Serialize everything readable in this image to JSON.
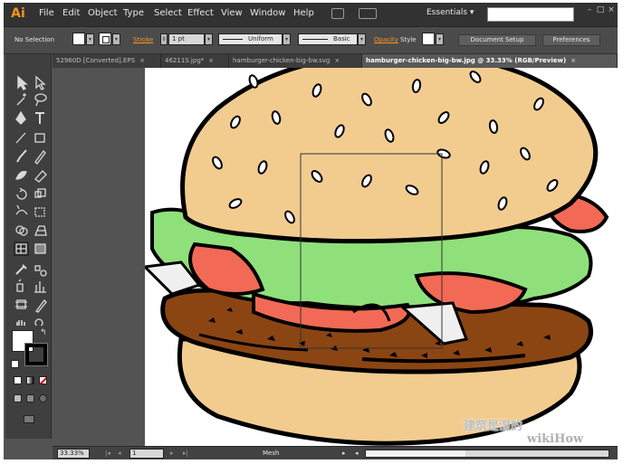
{
  "app": {
    "logo": "Ai",
    "menu": [
      "File",
      "Edit",
      "Object",
      "Type",
      "Select",
      "Effect",
      "View",
      "Window",
      "Help"
    ],
    "workspace": "Essentials",
    "workspace_arrow": "▾",
    "search_value": "",
    "window_buttons": [
      "–",
      "□",
      "×"
    ]
  },
  "control_bar": {
    "selection": "No Selection",
    "stroke_label": "Stroke",
    "stroke_weight": "1 pt",
    "profile": "Uniform",
    "brush": "Basic",
    "opacity_label": "Opacity",
    "style_label": "Style",
    "document_setup": "Document Setup",
    "preferences": "Preferences"
  },
  "tabs": [
    {
      "label": "52960D [Converted].EPS",
      "close": "×"
    },
    {
      "label": "46211S.jpg*",
      "close": "×"
    },
    {
      "label": "hamburger-chicken-big-bw.svg",
      "close": "×"
    },
    {
      "label": "hamburger-chicken-big-bw.jpg @ 33.33% (RGB/Preview)",
      "close": "×"
    }
  ],
  "status": {
    "zoom": "33.33%",
    "page": "1",
    "tool": "Mesh",
    "first": "|◂",
    "prev": "◂",
    "next": "▸",
    "last": "▸|",
    "play": "▸",
    "scroll_left": "◂"
  },
  "watermark": {
    "line1": "建筑是湿的",
    "line2": "wikiHow"
  },
  "colors": {
    "bun": "#f2cc8f",
    "tomato": "#f26a55",
    "lettuce": "#8fe07a",
    "patty": "#8b4513",
    "accent": "#f7941e"
  },
  "tools": [
    "selection-tool",
    "direct-selection-tool",
    "magic-wand-tool",
    "lasso-tool",
    "pen-tool",
    "type-tool",
    "line-tool",
    "rectangle-tool",
    "paintbrush-tool",
    "pencil-tool",
    "blob-brush-tool",
    "eraser-tool",
    "rotate-tool",
    "scale-tool",
    "width-tool",
    "free-transform-tool",
    "shape-builder-tool",
    "perspective-grid-tool",
    "mesh-tool",
    "gradient-tool",
    "eyedropper-tool",
    "blend-tool",
    "symbol-sprayer-tool",
    "graph-tool",
    "artboard-tool",
    "slice-tool",
    "hand-tool",
    "zoom-tool"
  ]
}
